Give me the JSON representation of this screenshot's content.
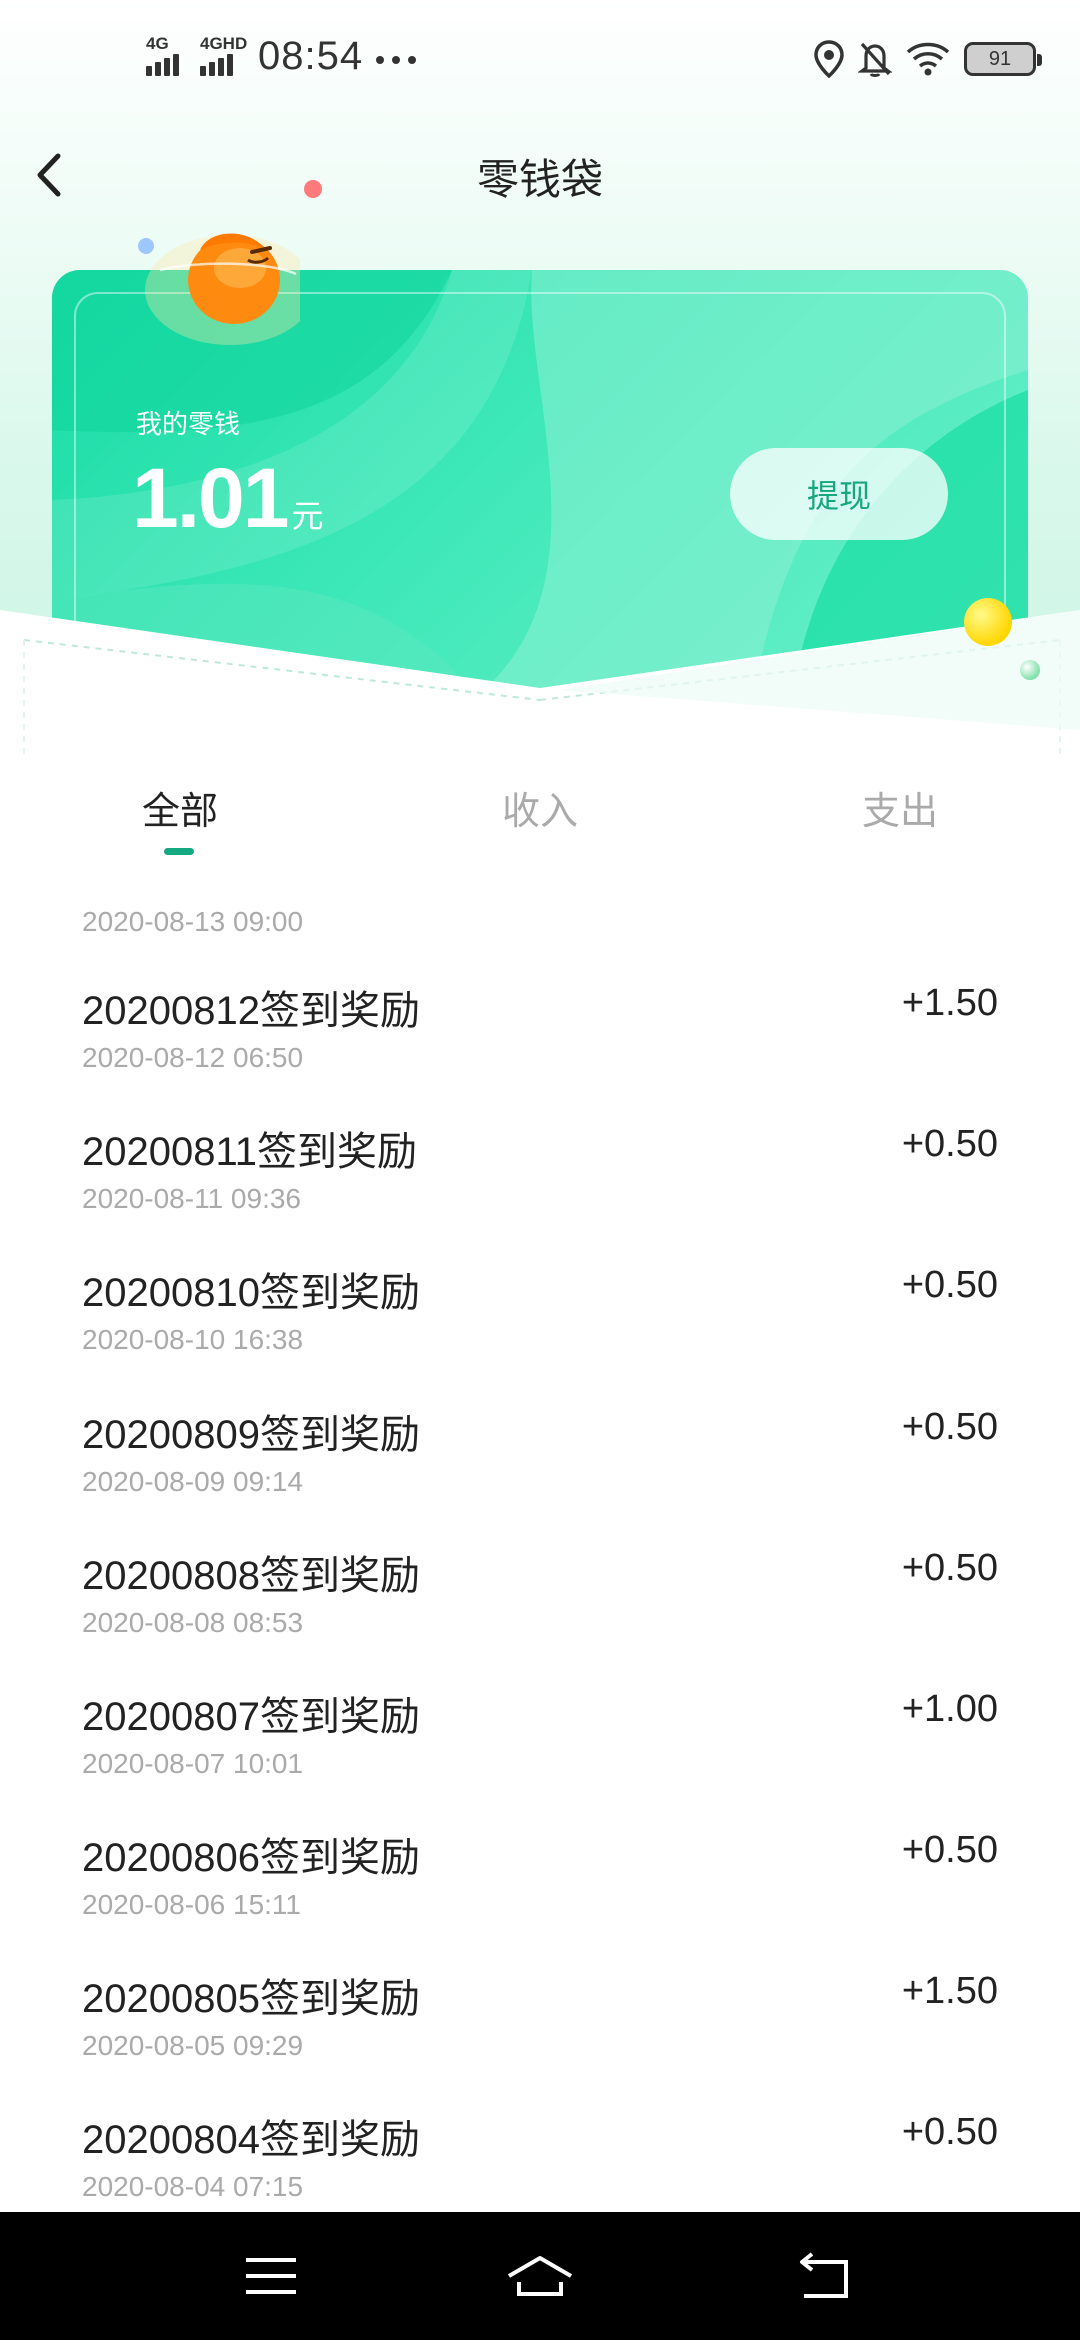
{
  "status_bar": {
    "network1": "4G",
    "network2": "4GHD",
    "time": "08:54",
    "dots": "•••",
    "battery": "91",
    "icons": [
      "location-icon",
      "bell-off-icon",
      "wifi-icon",
      "battery-icon"
    ]
  },
  "header": {
    "title": "零钱袋",
    "back_icon": "chevron-left-icon"
  },
  "card": {
    "label": "我的零钱",
    "amount": "1.01",
    "unit": "元",
    "withdraw_label": "提现"
  },
  "tabs": [
    {
      "label": "全部",
      "active": true
    },
    {
      "label": "收入",
      "active": false
    },
    {
      "label": "支出",
      "active": false
    }
  ],
  "list": {
    "clipped_date": "2020-08-13 09:00",
    "items": [
      {
        "title": "20200812签到奖励",
        "date": "2020-08-12 06:50",
        "amount": "+1.50"
      },
      {
        "title": "20200811签到奖励",
        "date": "2020-08-11 09:36",
        "amount": "+0.50"
      },
      {
        "title": "20200810签到奖励",
        "date": "2020-08-10 16:38",
        "amount": "+0.50"
      },
      {
        "title": "20200809签到奖励",
        "date": "2020-08-09 09:14",
        "amount": "+0.50"
      },
      {
        "title": "20200808签到奖励",
        "date": "2020-08-08 08:53",
        "amount": "+0.50"
      },
      {
        "title": "20200807签到奖励",
        "date": "2020-08-07 10:01",
        "amount": "+1.00"
      },
      {
        "title": "20200806签到奖励",
        "date": "2020-08-06 15:11",
        "amount": "+0.50"
      },
      {
        "title": "20200805签到奖励",
        "date": "2020-08-05 09:29",
        "amount": "+1.50"
      },
      {
        "title": "20200804签到奖励",
        "date": "2020-08-04 07:15",
        "amount": "+0.50"
      }
    ]
  },
  "nav_bar": {
    "icons": [
      "menu-icon",
      "home-icon",
      "back-icon"
    ]
  },
  "colors": {
    "accent": "#15a982",
    "card_green": "#19dca6",
    "withdraw_text": "#17a77c"
  }
}
